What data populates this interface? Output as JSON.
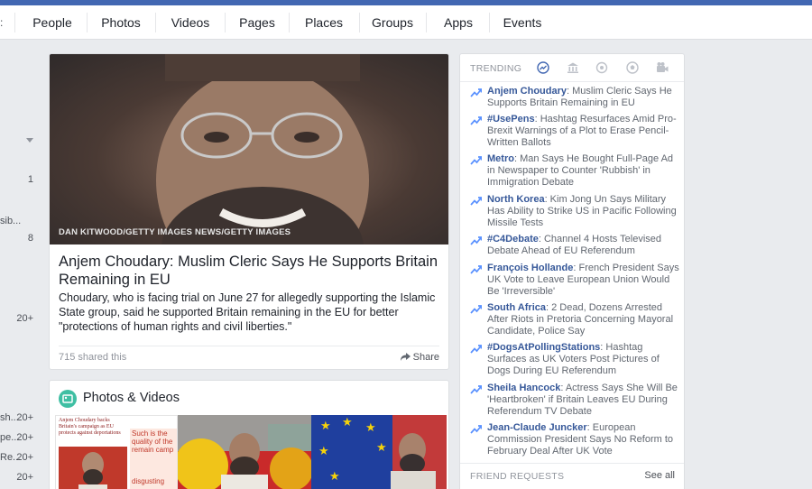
{
  "nav": {
    "edge_glyph": ":",
    "tabs": [
      "People",
      "Photos",
      "Videos",
      "Pages",
      "Places",
      "Groups",
      "Apps",
      "Events"
    ]
  },
  "left_column": {
    "counts": [
      "1",
      "8",
      "20+",
      "20+",
      "20+",
      "20+",
      "20+"
    ],
    "labels": [
      "sib...",
      "sh...",
      "pe...",
      "Re..."
    ]
  },
  "news": {
    "image_credit": "DAN KITWOOD/GETTY IMAGES NEWS/GETTY IMAGES",
    "topic": "Anjem Choudary",
    "headline": ": Muslim Cleric Says He Supports Britain Remaining in EU",
    "description": "Choudary, who is facing trial on June 27 for allegedly supporting the Islamic State group, said he supported Britain remaining in the EU for better \"protections of human rights and civil liberties.\"",
    "shared": "715 shared this",
    "share_label": "Share"
  },
  "photos_videos": {
    "title": "Photos & Videos",
    "thumb1_caption": "Anjem Choudary backs Britain's campaign as EU protects against deportations",
    "thumb1_quote": "Such is the quality of the remain camp",
    "thumb1_quote2": "disgusting"
  },
  "trending": {
    "header": "TRENDING",
    "icons": [
      "trending-icon",
      "politics-icon",
      "science-icon",
      "sports-icon",
      "entertainment-icon"
    ],
    "items": [
      {
        "name": "Anjem Choudary",
        "text": ": Muslim Cleric Says He Supports Britain Remaining in EU"
      },
      {
        "name": "#UsePens",
        "text": ": Hashtag Resurfaces Amid Pro-Brexit Warnings of a Plot to Erase Pencil-Written Ballots"
      },
      {
        "name": "Metro",
        "text": ": Man Says He Bought Full-Page Ad in Newspaper to Counter 'Rubbish' in Immigration Debate"
      },
      {
        "name": "North Korea",
        "text": ": Kim Jong Un Says Military Has Ability to Strike US in Pacific Following Missile Tests"
      },
      {
        "name": "#C4Debate",
        "text": ": Channel 4 Hosts Televised Debate Ahead of EU Referendum"
      },
      {
        "name": "François Hollande",
        "text": ": French President Says UK Vote to Leave European Union Would Be 'Irreversible'"
      },
      {
        "name": "South Africa",
        "text": ": 2 Dead, Dozens Arrested After Riots in Pretoria Concerning Mayoral Candidate, Police Say"
      },
      {
        "name": "#DogsAtPollingStations",
        "text": ": Hashtag Surfaces as UK Voters Post Pictures of Dogs During EU Referendum"
      },
      {
        "name": "Sheila Hancock",
        "text": ": Actress Says She Will Be 'Heartbroken' if Britain Leaves EU During Referendum TV Debate"
      },
      {
        "name": "Jean-Claude Juncker",
        "text": ": European Commission President Says No Reform to February Deal After UK Vote"
      }
    ],
    "friend_requests": "FRIEND REQUESTS",
    "see_all": "See all"
  },
  "colors": {
    "brand": "#4267b2",
    "link": "#365899",
    "background": "#e9ebee"
  }
}
